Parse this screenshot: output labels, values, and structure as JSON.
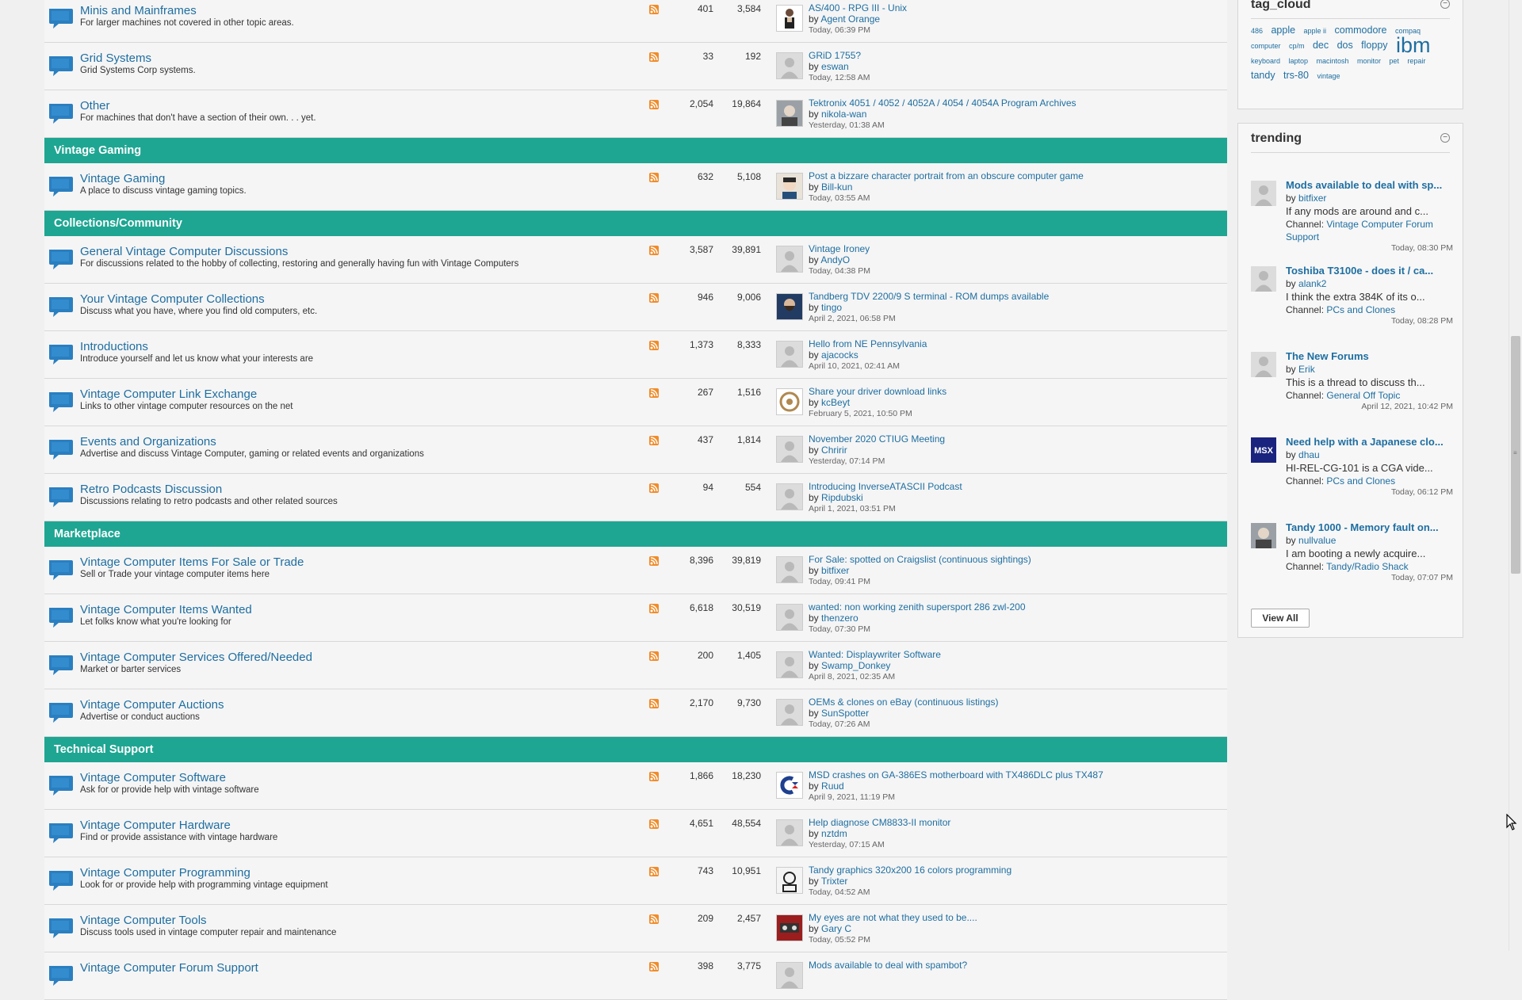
{
  "forums": [
    {
      "kind": "forum",
      "title": "Minis and Mainframes",
      "desc": "For larger machines not covered in other topic areas.",
      "threads": "401",
      "posts": "3,584",
      "lp_title": "AS/400 - RPG III - Unix",
      "lp_by": "Agent Orange",
      "lp_time": "Today, 06:39 PM",
      "avatar": "person"
    },
    {
      "kind": "forum",
      "title": "Grid Systems",
      "desc": "Grid Systems Corp systems.",
      "threads": "33",
      "posts": "192",
      "lp_title": "GRiD 1755?",
      "lp_by": "eswan",
      "lp_time": "Today, 12:58 AM",
      "avatar": "default"
    },
    {
      "kind": "forum",
      "title": "Other",
      "desc": "For machines that don't have a section of their own. . . yet.",
      "threads": "2,054",
      "posts": "19,864",
      "lp_title": "Tektronix 4051 / 4052 / 4052A / 4054 / 4054A Program Archives",
      "lp_by": "nikola-wan",
      "lp_time": "Yesterday, 01:38 AM",
      "avatar": "photo"
    },
    {
      "kind": "cat",
      "title": "Vintage Gaming"
    },
    {
      "kind": "forum",
      "title": "Vintage Gaming",
      "desc": "A place to discuss vintage gaming topics.",
      "threads": "632",
      "posts": "5,108",
      "lp_title": "Post a bizzare character portrait from an obscure computer game",
      "lp_by": "Bill-kun",
      "lp_time": "Today, 03:55 AM",
      "avatar": "face"
    },
    {
      "kind": "cat",
      "title": "Collections/Community"
    },
    {
      "kind": "forum",
      "title": "General Vintage Computer Discussions",
      "desc": "For discussions related to the hobby of collecting, restoring and generally having fun with Vintage Computers",
      "threads": "3,587",
      "posts": "39,891",
      "lp_title": "Vintage Ironey",
      "lp_by": "AndyO",
      "lp_time": "Today, 04:38 PM",
      "avatar": "default"
    },
    {
      "kind": "forum",
      "title": "Your Vintage Computer Collections",
      "desc": "Discuss what you have, where you find old computers, etc.",
      "threads": "946",
      "posts": "9,006",
      "lp_title": "Tandberg TDV 2200/9 S terminal - ROM dumps available",
      "lp_by": "tingo",
      "lp_time": "April 2, 2021, 06:58 PM",
      "avatar": "beard"
    },
    {
      "kind": "forum",
      "title": "Introductions",
      "desc": "Introduce yourself and let us know what your interests are",
      "threads": "1,373",
      "posts": "8,333",
      "lp_title": "Hello from NE Pennsylvania",
      "lp_by": "ajacocks",
      "lp_time": "April 10, 2021, 02:41 AM",
      "avatar": "default"
    },
    {
      "kind": "forum",
      "title": "Vintage Computer Link Exchange",
      "desc": "Links to other vintage computer resources on the net",
      "threads": "267",
      "posts": "1,516",
      "lp_title": "Share your driver download links",
      "lp_by": "kcBeyt",
      "lp_time": "February 5, 2021, 10:50 PM",
      "avatar": "emblem"
    },
    {
      "kind": "forum",
      "title": "Events and Organizations",
      "desc": "Advertise and discuss Vintage Computer, gaming or related events and organizations",
      "threads": "437",
      "posts": "1,814",
      "lp_title": "November 2020 CTIUG Meeting",
      "lp_by": "Chririr",
      "lp_time": "Yesterday, 07:14 PM",
      "avatar": "default"
    },
    {
      "kind": "forum",
      "title": "Retro Podcasts Discussion",
      "desc": "Discussions relating to retro podcasts and other related sources",
      "threads": "94",
      "posts": "554",
      "lp_title": "Introducing InverseATASCII Podcast",
      "lp_by": "Ripdubski",
      "lp_time": "April 1, 2021, 03:51 PM",
      "avatar": "default"
    },
    {
      "kind": "cat",
      "title": "Marketplace"
    },
    {
      "kind": "forum",
      "title": "Vintage Computer Items For Sale or Trade",
      "desc": "Sell or Trade your vintage computer items here",
      "threads": "8,396",
      "posts": "39,819",
      "lp_title": "For Sale: spotted on Craigslist (continuous sightings)",
      "lp_by": "bitfixer",
      "lp_time": "Today, 09:41 PM",
      "avatar": "default"
    },
    {
      "kind": "forum",
      "title": "Vintage Computer Items Wanted",
      "desc": "Let folks know what you're looking for",
      "threads": "6,618",
      "posts": "30,519",
      "lp_title": "wanted: non working zenith supersport 286 zwl-200",
      "lp_by": "thenzero",
      "lp_time": "Today, 07:30 PM",
      "avatar": "default"
    },
    {
      "kind": "forum",
      "title": "Vintage Computer Services Offered/Needed",
      "desc": "Market or barter services",
      "threads": "200",
      "posts": "1,405",
      "lp_title": "Wanted: Displaywriter Software",
      "lp_by": "Swamp_Donkey",
      "lp_time": "April 8, 2021, 02:35 AM",
      "avatar": "default"
    },
    {
      "kind": "forum",
      "title": "Vintage Computer Auctions",
      "desc": "Advertise or conduct auctions",
      "threads": "2,170",
      "posts": "9,730",
      "lp_title": "OEMs & clones on eBay (continuous listings)",
      "lp_by": "SunSpotter",
      "lp_time": "Today, 07:26 AM",
      "avatar": "default"
    },
    {
      "kind": "cat",
      "title": "Technical Support"
    },
    {
      "kind": "forum",
      "title": "Vintage Computer Software",
      "desc": "Ask for or provide help with vintage software",
      "threads": "1,866",
      "posts": "18,230",
      "lp_title": "MSD crashes on GA-386ES motherboard with TX486DLC plus TX487",
      "lp_by": "Ruud",
      "lp_time": "April 9, 2021, 11:19 PM",
      "avatar": "commodore"
    },
    {
      "kind": "forum",
      "title": "Vintage Computer Hardware",
      "desc": "Find or provide assistance with vintage hardware",
      "threads": "4,651",
      "posts": "48,554",
      "lp_title": "Help diagnose CM8833-II monitor",
      "lp_by": "nztdm",
      "lp_time": "Yesterday, 07:15 AM",
      "avatar": "default"
    },
    {
      "kind": "forum",
      "title": "Vintage Computer Programming",
      "desc": "Look for or provide help with programming vintage equipment",
      "threads": "743",
      "posts": "10,951",
      "lp_title": "Tandy graphics 320x200 16 colors programming",
      "lp_by": "Trixter",
      "lp_time": "Today, 04:52 AM",
      "avatar": "sketch"
    },
    {
      "kind": "forum",
      "title": "Vintage Computer Tools",
      "desc": "Discuss tools used in vintage computer repair and maintenance",
      "threads": "209",
      "posts": "2,457",
      "lp_title": "My eyes are not what they used to be....",
      "lp_by": "Gary C",
      "lp_time": "Today, 05:52 PM",
      "avatar": "red"
    },
    {
      "kind": "forum",
      "title": "Vintage Computer Forum Support",
      "desc": "",
      "threads": "398",
      "posts": "3,775",
      "lp_title": "Mods available to deal with spambot?",
      "lp_by": "",
      "lp_time": "",
      "avatar": "default"
    }
  ],
  "tag_cloud": {
    "title": "tag_cloud",
    "tags": [
      {
        "t": "486",
        "s": "s"
      },
      {
        "t": "apple",
        "s": "m"
      },
      {
        "t": "apple ii",
        "s": "s"
      },
      {
        "t": "commodore",
        "s": "m"
      },
      {
        "t": "compaq",
        "s": "s"
      },
      {
        "t": "computer",
        "s": "s"
      },
      {
        "t": "cp/m",
        "s": "s"
      },
      {
        "t": "dec",
        "s": "m"
      },
      {
        "t": "dos",
        "s": "m"
      },
      {
        "t": "floppy",
        "s": "m"
      },
      {
        "t": "ibm",
        "s": "xl"
      },
      {
        "t": "keyboard",
        "s": "s"
      },
      {
        "t": "laptop",
        "s": "s"
      },
      {
        "t": "macintosh",
        "s": "s"
      },
      {
        "t": "monitor",
        "s": "s"
      },
      {
        "t": "pet",
        "s": "s"
      },
      {
        "t": "repair",
        "s": "s"
      },
      {
        "t": "tandy",
        "s": "m"
      },
      {
        "t": "trs-80",
        "s": "m"
      },
      {
        "t": "vintage",
        "s": "s"
      }
    ]
  },
  "trending": {
    "title": "trending",
    "view_all": "View All",
    "items": [
      {
        "title": "Mods available to deal with sp...",
        "by": "bitfixer",
        "excerpt": "If any mods are around and c...",
        "channel_label": "Channel:",
        "channel": "Vintage Computer Forum Support",
        "time": "Today, 08:30 PM",
        "avatar": "default"
      },
      {
        "title": "Toshiba T3100e - does it / ca...",
        "by": "alank2",
        "excerpt": "I think the extra 384K of its o...",
        "channel_label": "Channel:",
        "channel": "PCs and Clones",
        "time": "Today, 08:28 PM",
        "avatar": "default"
      },
      {
        "title": "The New Forums",
        "by": "Erik",
        "excerpt": "This is a thread to discuss th...",
        "channel_label": "Channel:",
        "channel": "General Off Topic",
        "time": "April 12, 2021, 10:42 PM",
        "avatar": "default"
      },
      {
        "title": "Need help with a Japanese clo...",
        "by": "dhau",
        "excerpt": "HI-REL-CG-101 is a CGA vide...",
        "channel_label": "Channel:",
        "channel": "PCs and Clones",
        "time": "Today, 06:12 PM",
        "avatar": "msx"
      },
      {
        "title": "Tandy 1000 - Memory fault on...",
        "by": "nullvalue",
        "excerpt": "I am booting a newly acquire...",
        "channel_label": "Channel:",
        "channel": "Tandy/Radio Shack",
        "time": "Today, 07:07 PM",
        "avatar": "photo"
      }
    ]
  },
  "labels": {
    "by": "by",
    "msx": "MSX"
  },
  "colors": {
    "category_bg": "#1ea692",
    "link": "#1e6ea1",
    "rss": "#f08c2a"
  }
}
